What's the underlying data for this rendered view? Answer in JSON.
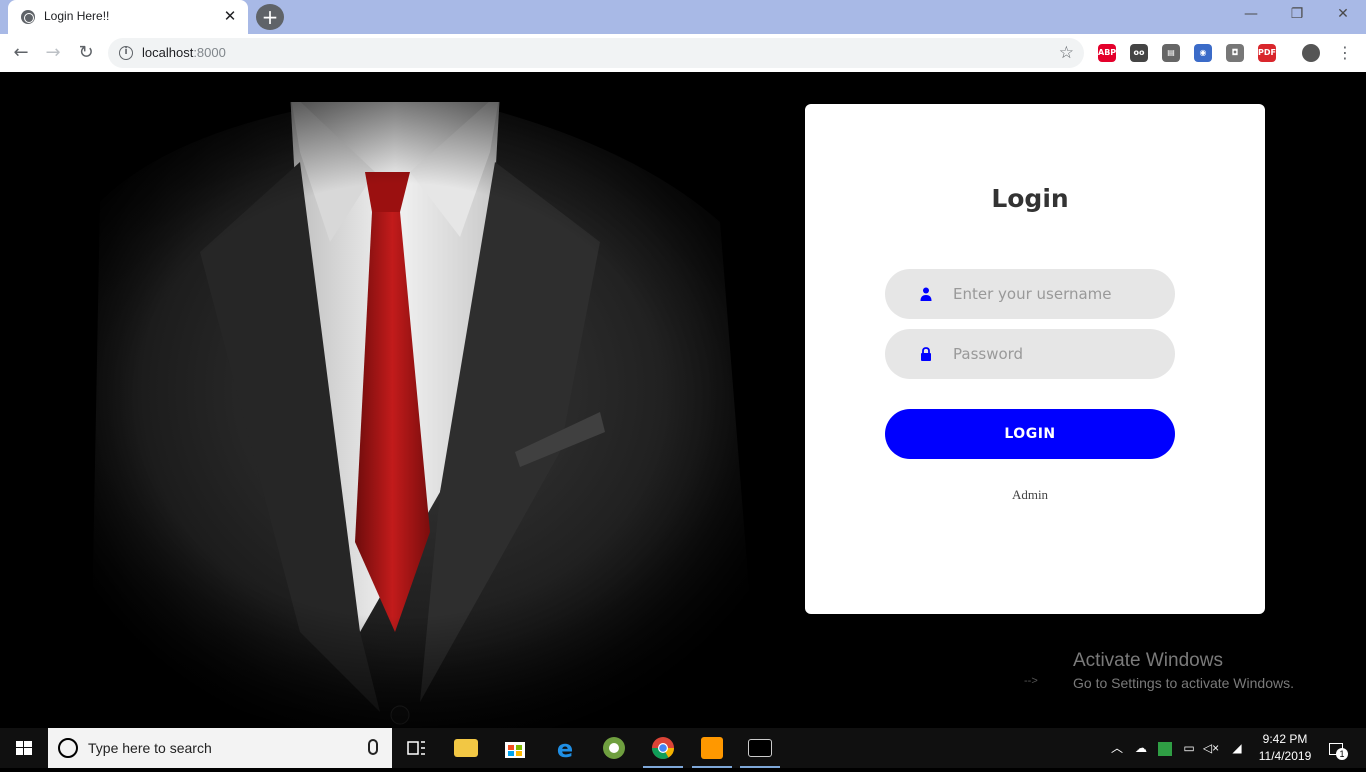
{
  "browser": {
    "tab_title": "Login Here!!",
    "tab_close": "✕",
    "new_tab": "+",
    "window_controls": {
      "minimize": "—",
      "restore": "❐",
      "close": "✕"
    },
    "url_host": "localhost",
    "url_port": ":8000",
    "nav": {
      "back": "←",
      "forward": "→",
      "reload": "↻"
    },
    "star": "☆",
    "extensions": [
      {
        "name": "adblock-plus",
        "label": "ABP",
        "color": "#e4002b"
      },
      {
        "name": "reader",
        "label": "oo",
        "color": "#444444"
      },
      {
        "name": "docs",
        "label": "▤",
        "color": "#666666"
      },
      {
        "name": "owl",
        "label": "◉",
        "color": "#3b6bc8"
      },
      {
        "name": "screenshot",
        "label": "◘",
        "color": "#777777"
      },
      {
        "name": "pdf",
        "label": "PDF",
        "color": "#d9262c"
      }
    ],
    "menu": "⋮"
  },
  "login": {
    "title": "Login",
    "username_placeholder": "Enter your username",
    "password_placeholder": "Password",
    "button_label": "LOGIN",
    "admin_link": "Admin",
    "accent_color": "#0000ff"
  },
  "watermark": {
    "line1": "Activate Windows",
    "line2": "Go to Settings to activate Windows.",
    "stray_text": "-->"
  },
  "taskbar": {
    "search_placeholder": "Type here to search",
    "time": "9:42 PM",
    "date": "11/4/2019",
    "notification_count": "1"
  }
}
